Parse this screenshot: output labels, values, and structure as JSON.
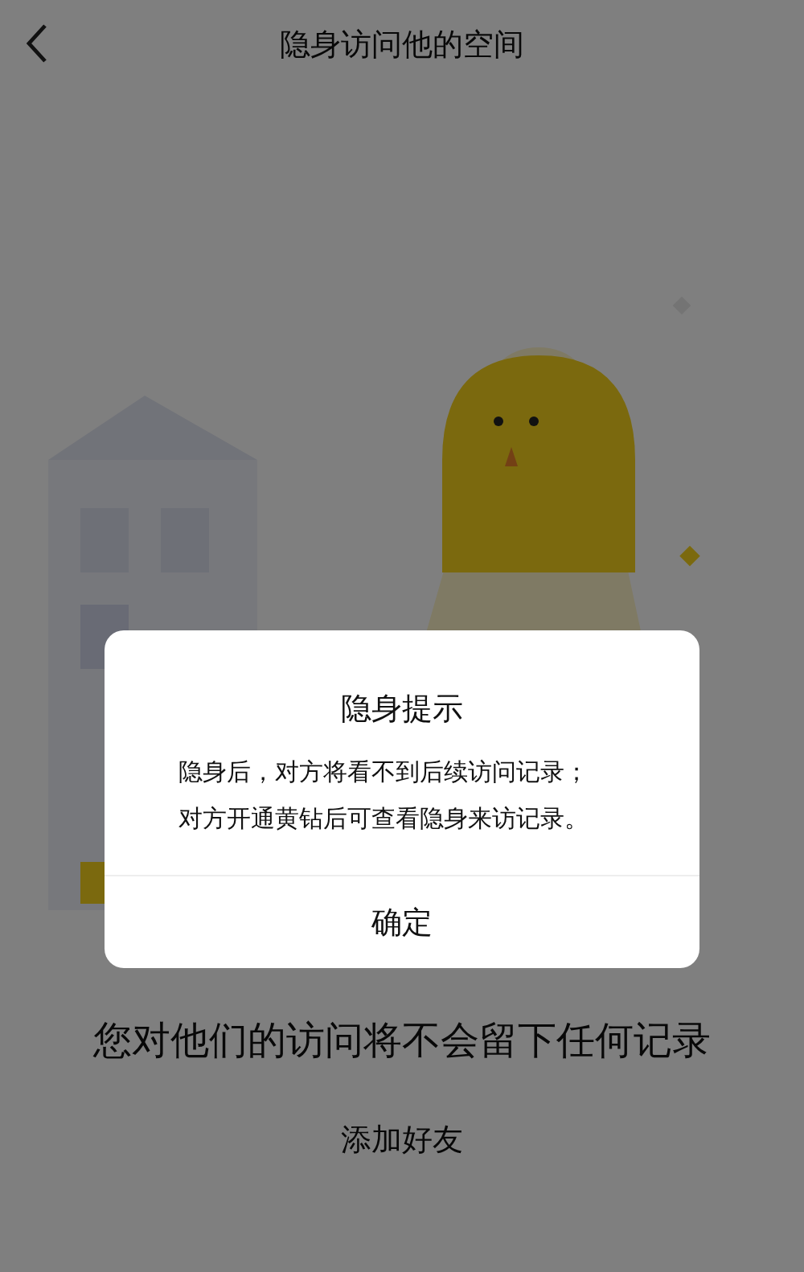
{
  "header": {
    "title": "隐身访问他的空间"
  },
  "heading": "您对他们的访问将不会留下任何记录",
  "add_friend_button": "添加好友",
  "dialog": {
    "title": "隐身提示",
    "message": "隐身后，对方将看不到后续访问记录；对方开通黄钻后可查看隐身来访记录。",
    "confirm_button": "确定"
  }
}
